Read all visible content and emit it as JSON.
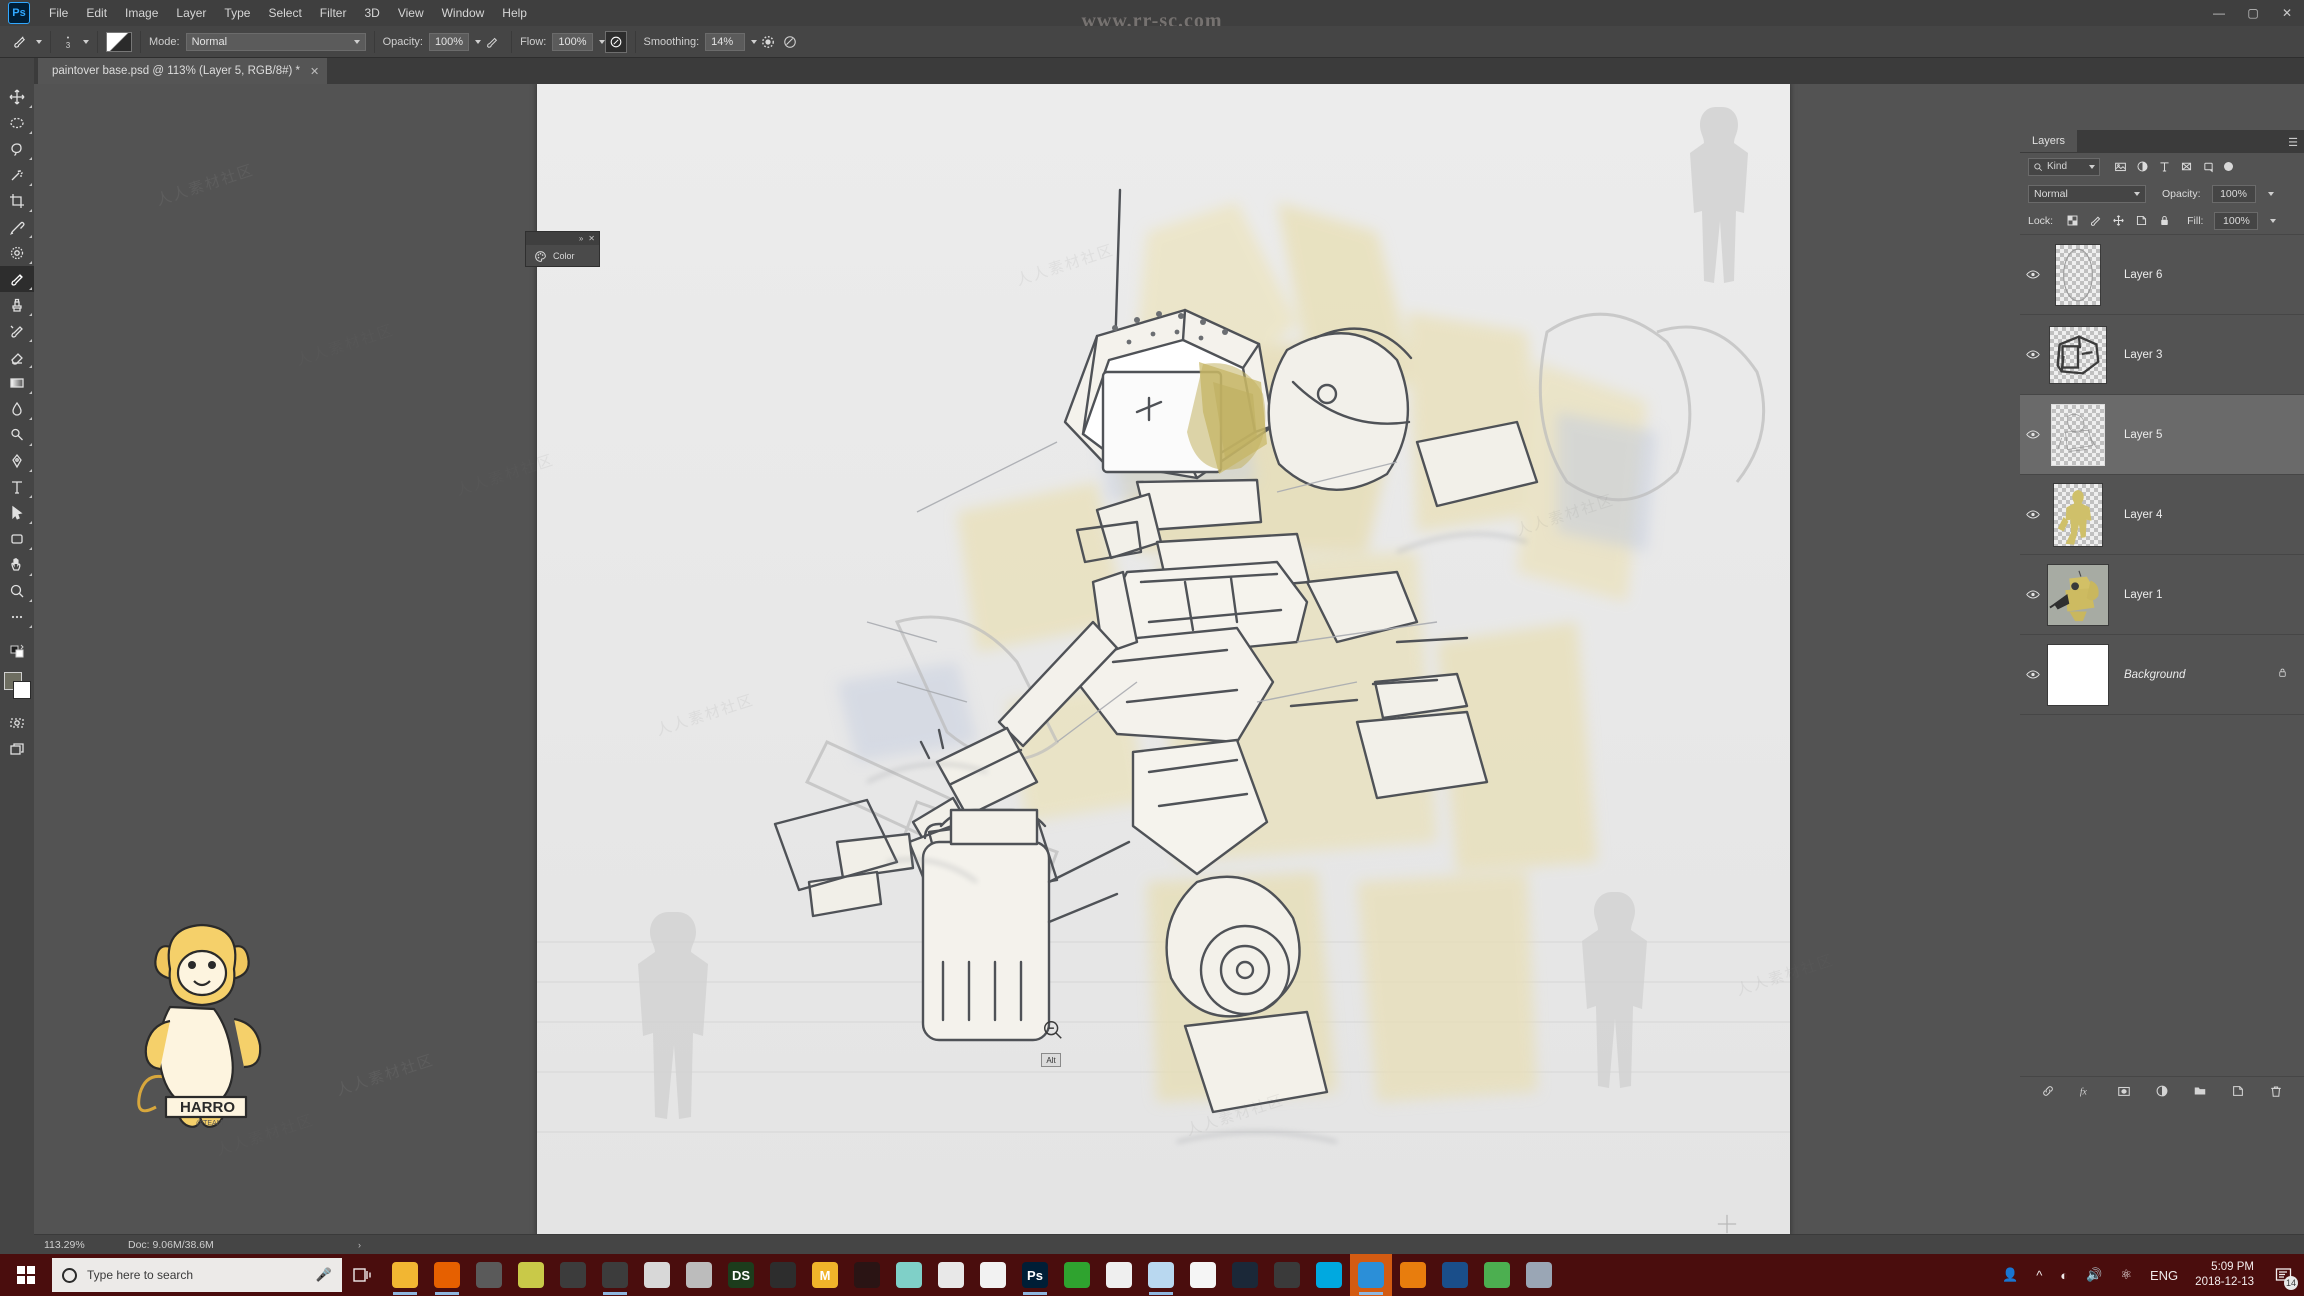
{
  "window": {
    "watermark_top": "www.rr-sc.com",
    "watermark_text": "人人素材社区",
    "controls": {
      "minimize": "—",
      "maximize": "▢",
      "close": "✕"
    }
  },
  "menubar": {
    "app_badge": "Ps",
    "items": [
      "File",
      "Edit",
      "Image",
      "Layer",
      "Type",
      "Select",
      "Filter",
      "3D",
      "View",
      "Window",
      "Help"
    ]
  },
  "options_bar": {
    "tool_icon": "brush-tool",
    "brush_size": "3",
    "mode_label": "Mode:",
    "mode_value": "Normal",
    "opacity_label": "Opacity:",
    "opacity_value": "100%",
    "flow_label": "Flow:",
    "flow_value": "100%",
    "smoothing_label": "Smoothing:",
    "smoothing_value": "14%",
    "airbrush_icon": "airbrush-icon",
    "pressure_opacity_icon": "pressure-opacity-icon",
    "pressure_size_icon": "pressure-size-icon",
    "smoothing_options_icon": "gear-icon",
    "symmetry_icon": "symmetry-icon"
  },
  "document": {
    "tab_title": "paintover base.psd @ 113% (Layer 5, RGB/8#) *",
    "tab_close": "✕"
  },
  "toolbar": {
    "tools": [
      {
        "name": "move-tool",
        "glyph": "move"
      },
      {
        "name": "marquee-tool",
        "glyph": "marquee"
      },
      {
        "name": "lasso-tool",
        "glyph": "lasso"
      },
      {
        "name": "magic-wand-tool",
        "glyph": "wand"
      },
      {
        "name": "crop-tool",
        "glyph": "crop"
      },
      {
        "name": "eyedropper-tool",
        "glyph": "eyedropper"
      },
      {
        "name": "spot-healing-tool",
        "glyph": "healing"
      },
      {
        "name": "brush-tool",
        "glyph": "brush",
        "selected": true
      },
      {
        "name": "clone-stamp-tool",
        "glyph": "stamp"
      },
      {
        "name": "history-brush-tool",
        "glyph": "historybrush"
      },
      {
        "name": "eraser-tool",
        "glyph": "eraser"
      },
      {
        "name": "gradient-tool",
        "glyph": "gradient"
      },
      {
        "name": "blur-tool",
        "glyph": "blur"
      },
      {
        "name": "dodge-tool",
        "glyph": "dodge"
      },
      {
        "name": "pen-tool",
        "glyph": "pen"
      },
      {
        "name": "type-tool",
        "glyph": "T"
      },
      {
        "name": "path-selection-tool",
        "glyph": "arrow"
      },
      {
        "name": "rectangle-tool",
        "glyph": "rect"
      },
      {
        "name": "hand-tool",
        "glyph": "hand"
      },
      {
        "name": "zoom-tool",
        "glyph": "zoom"
      },
      {
        "name": "edit-toolbar-button",
        "glyph": "dots"
      }
    ],
    "foreground_color": "#6e6e61",
    "background_color": "#ffffff",
    "quick_mask_icon": "quick-mask-icon",
    "screen_mode_icon": "screen-mode-icon"
  },
  "color_panel": {
    "title": "Color",
    "collapse": "»",
    "close": "✕",
    "icon": "color-wheel-icon"
  },
  "canvas": {
    "zoom_cursor_icon": "zoom-out-cursor",
    "alt_badge": "Alt",
    "crosshair_icon": "crosshair-icon"
  },
  "layers_panel": {
    "tab_label": "Layers",
    "menu_icon": "panel-menu-icon",
    "filter": {
      "search_icon": "search-icon",
      "kind_label": "Kind",
      "pixel_filter_icon": "pixel-layer-icon",
      "adjustment_filter_icon": "adjustment-layer-icon",
      "type_filter_icon": "type-layer-icon",
      "shape_filter_icon": "shape-layer-icon",
      "smart_filter_icon": "smart-object-icon",
      "filter_toggle_icon": "filter-toggle"
    },
    "blend_mode": "Normal",
    "opacity_label": "Opacity:",
    "opacity_value": "100%",
    "lock_label": "Lock:",
    "lock_icons": [
      "lock-transparent-pixels",
      "lock-image-pixels",
      "lock-position",
      "lock-artboard",
      "lock-all"
    ],
    "fill_label": "Fill:",
    "fill_value": "100%",
    "layers": [
      {
        "name": "Layer 6",
        "visible": true,
        "selected": false,
        "locked": false,
        "thumb": "ellipse-sketch"
      },
      {
        "name": "Layer 3",
        "visible": true,
        "selected": false,
        "locked": false,
        "thumb": "cockpit-lineart"
      },
      {
        "name": "Layer 5",
        "visible": true,
        "selected": true,
        "locked": false,
        "thumb": "faint-sketch"
      },
      {
        "name": "Layer 4",
        "visible": true,
        "selected": false,
        "locked": false,
        "thumb": "yellow-figure"
      },
      {
        "name": "Layer 1",
        "visible": true,
        "selected": false,
        "locked": false,
        "thumb": "mech-color"
      },
      {
        "name": "Background",
        "visible": true,
        "selected": false,
        "locked": true,
        "thumb": "white"
      }
    ],
    "footer_buttons": [
      {
        "name": "link-layers-button",
        "glyph": "link"
      },
      {
        "name": "layer-style-button",
        "glyph": "fx"
      },
      {
        "name": "add-mask-button",
        "glyph": "mask"
      },
      {
        "name": "adjustment-layer-button",
        "glyph": "halfcircle"
      },
      {
        "name": "new-group-button",
        "glyph": "folder"
      },
      {
        "name": "new-layer-button",
        "glyph": "newlayer"
      },
      {
        "name": "delete-layer-button",
        "glyph": "trash"
      }
    ]
  },
  "status_bar": {
    "zoom": "113.29%",
    "doc_info": "Doc: 9.06M/38.6M",
    "expand_arrow": "›"
  },
  "taskbar": {
    "start_icon": "windows-start-icon",
    "search_placeholder": "Type here to search",
    "search_icon": "cortana-circle-icon",
    "mic_icon": "microphone-icon",
    "task_view_icon": "task-view-icon",
    "apps": [
      {
        "name": "file-explorer",
        "label": "",
        "color": "#f2b632",
        "running": true
      },
      {
        "name": "firefox",
        "label": "",
        "color": "#e66000",
        "running": true
      },
      {
        "name": "quicklook",
        "label": "",
        "color": "#5a5a5a",
        "running": false
      },
      {
        "name": "krita",
        "label": "",
        "color": "#c9c948",
        "running": false
      },
      {
        "name": "clip-studio-a",
        "label": "",
        "color": "#3c3c3c",
        "running": false
      },
      {
        "name": "clip-studio-b",
        "label": "",
        "color": "#3c3c3c",
        "running": true
      },
      {
        "name": "sports-app",
        "label": "",
        "color": "#d8d8d8",
        "running": false
      },
      {
        "name": "spiral-app",
        "label": "",
        "color": "#bcbcbc",
        "running": false
      },
      {
        "name": "designspark",
        "label": "DS",
        "color": "#1c3c1c",
        "running": false
      },
      {
        "name": "green-eye-app",
        "label": "",
        "color": "#2d2d2d",
        "running": false
      },
      {
        "name": "media-app",
        "label": "M",
        "color": "#f0b32a",
        "running": false
      },
      {
        "name": "dark-app",
        "label": "",
        "color": "#2a1414",
        "running": false
      },
      {
        "name": "teal-app",
        "label": "",
        "color": "#7fd0c8",
        "running": false
      },
      {
        "name": "circle-slash-app",
        "label": "",
        "color": "#e8e8e8",
        "running": false
      },
      {
        "name": "document-app",
        "label": "",
        "color": "#f2f2f2",
        "running": false
      },
      {
        "name": "photoshop",
        "label": "Ps",
        "color": "#001e36",
        "running": true
      },
      {
        "name": "green-triangle-app",
        "label": "",
        "color": "#2fa32f",
        "running": false
      },
      {
        "name": "pointer-app",
        "label": "",
        "color": "#efefef",
        "running": false
      },
      {
        "name": "blue-doc-app",
        "label": "",
        "color": "#b9d8f0",
        "running": true
      },
      {
        "name": "white-arrow-app",
        "label": "",
        "color": "#f5f5f5",
        "running": false
      },
      {
        "name": "steam",
        "label": "",
        "color": "#1b2838",
        "running": false
      },
      {
        "name": "swirl-app",
        "label": "",
        "color": "#3a3a3a",
        "running": false
      },
      {
        "name": "logitech-app",
        "label": "",
        "color": "#00a9e0",
        "running": false
      },
      {
        "name": "chat-app",
        "label": "",
        "color": "#2b8fd8",
        "running": true,
        "active": true
      },
      {
        "name": "blender",
        "label": "",
        "color": "#e87d0d",
        "running": false
      },
      {
        "name": "opera-app",
        "label": "",
        "color": "#1a4e8a",
        "running": false
      },
      {
        "name": "green-globe-app",
        "label": "",
        "color": "#4caf50",
        "running": false
      },
      {
        "name": "lock-app",
        "label": "",
        "color": "#9aa6b5",
        "running": false
      }
    ],
    "tray": {
      "people_icon": "people-icon",
      "show_hidden_icon": "chevron-up-icon",
      "network_icon": "wifi-icon",
      "volume_icon": "speaker-icon",
      "bluetooth_icon": "bluetooth-icon",
      "language": "ENG",
      "time": "5:09 PM",
      "date": "2018-12-13",
      "notification_icon": "action-center-icon",
      "notification_count": "14"
    }
  }
}
